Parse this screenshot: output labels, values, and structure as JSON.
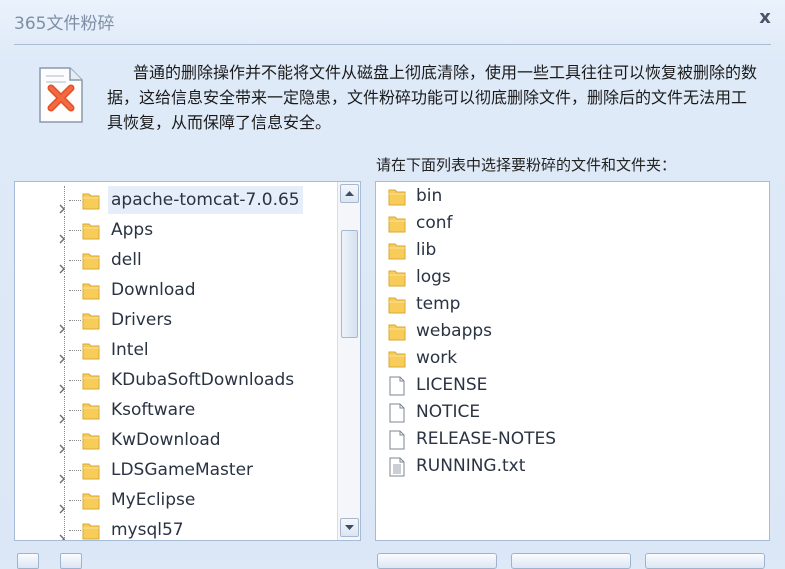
{
  "window": {
    "title": "365文件粉碎",
    "close_glyph": "x"
  },
  "description": {
    "icon": "shred-document-icon",
    "text": "普通的删除操作并不能将文件从磁盘上彻底清除，使用一些工具往往可以恢复被删除的数据，这给信息安全带来一定隐患，文件粉碎功能可以彻底删除文件，删除后的文件无法用工具恢复，从而保障了信息安全。"
  },
  "folder_tree": {
    "selected": "apache-tomcat-7.0.65",
    "items": [
      {
        "label": "apache-tomcat-7.0.65",
        "expandable": true
      },
      {
        "label": "Apps",
        "expandable": true
      },
      {
        "label": "dell",
        "expandable": true
      },
      {
        "label": "Download",
        "expandable": false
      },
      {
        "label": "Drivers",
        "expandable": true
      },
      {
        "label": "Intel",
        "expandable": true
      },
      {
        "label": "KDubaSoftDownloads",
        "expandable": true
      },
      {
        "label": "Ksoftware",
        "expandable": true
      },
      {
        "label": "KwDownload",
        "expandable": true
      },
      {
        "label": "LDSGameMaster",
        "expandable": true
      },
      {
        "label": "MyEclipse",
        "expandable": true
      },
      {
        "label": "mysql57",
        "expandable": true
      }
    ]
  },
  "file_list": {
    "caption": "请在下面列表中选择要粉碎的文件和文件夹：",
    "items": [
      {
        "label": "bin",
        "type": "folder"
      },
      {
        "label": "conf",
        "type": "folder"
      },
      {
        "label": "lib",
        "type": "folder"
      },
      {
        "label": "logs",
        "type": "folder"
      },
      {
        "label": "temp",
        "type": "folder"
      },
      {
        "label": "webapps",
        "type": "folder"
      },
      {
        "label": "work",
        "type": "folder"
      },
      {
        "label": "LICENSE",
        "type": "file"
      },
      {
        "label": "NOTICE",
        "type": "file"
      },
      {
        "label": "RELEASE-NOTES",
        "type": "file"
      },
      {
        "label": "RUNNING.txt",
        "type": "text-file"
      }
    ]
  },
  "colors": {
    "folder": "#f7cc58",
    "accent_border": "#a5bbd6",
    "selection": "#e6eef9"
  }
}
